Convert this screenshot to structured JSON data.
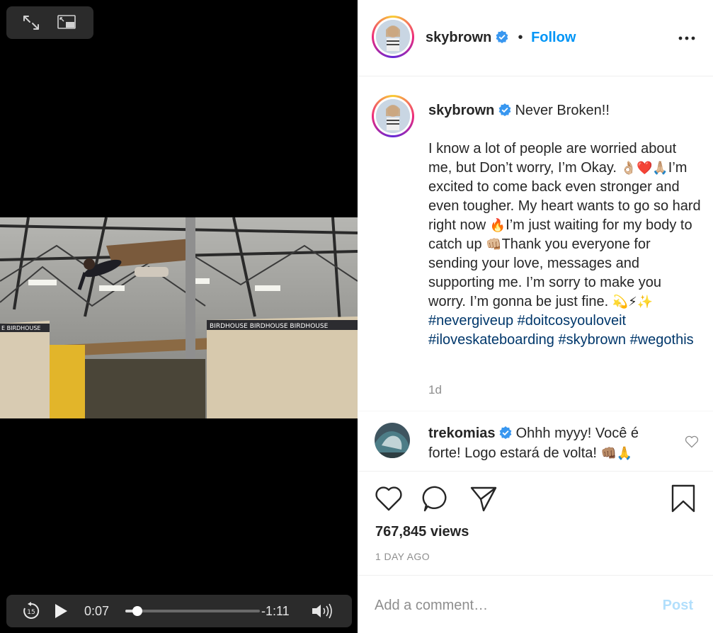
{
  "video": {
    "current_time": "0:07",
    "remaining_time": "-1:11",
    "progress": 0.09,
    "icons": {
      "expand": "expand-icon",
      "pip": "picture-in-picture-icon",
      "skip_back": "skip-back-15-icon",
      "skip_back_label": "15",
      "play": "play-icon",
      "volume": "volume-icon"
    },
    "frame_colors": {
      "ceiling": "#9a9a96",
      "ramp": "#d7c9ad",
      "banner": "#2c2c30",
      "banner_text": "BIRDHOUSE BIRDHOUSE BIRDHOUSE"
    }
  },
  "header": {
    "username": "skybrown",
    "separator": "•",
    "follow_label": "Follow",
    "more_icon": "more-options-icon"
  },
  "caption": {
    "username": "skybrown",
    "title": "Never Broken!!",
    "body_parts": [
      "I know a lot of people are worried about me, but Don’t worry, I’m Okay. ",
      "👌🏼❤️🙏🏼",
      "I’m excited to come back even stronger and even tougher. My heart wants to go so hard right now ",
      "🔥",
      "I’m just waiting for my body to catch up ",
      "👊🏼",
      "Thank you everyone for sending your love, messages and supporting me. I’m sorry to make you worry. I’m gonna be just fine. ",
      "💫⚡✨"
    ],
    "hashtags": "#nevergiveup #doitcosyouloveit #iloveskateboarding #skybrown #wegothis",
    "age": "1d"
  },
  "comment": {
    "username": "trekomias",
    "text": "Ohhh myyy! Você é forte! Logo estará de volta! ",
    "emoji": "👊🏽🙏"
  },
  "actions": {
    "like": "heart-icon",
    "comment": "comment-icon",
    "share": "share-icon",
    "save": "bookmark-icon"
  },
  "stats": {
    "views": "767,845 views",
    "date": "1 DAY AGO"
  },
  "compose": {
    "placeholder": "Add a comment…",
    "post_label": "Post"
  },
  "colors": {
    "link": "#0095f6",
    "hashtag": "#00376b",
    "muted": "#8e8e8e",
    "post_disabled": "#b2dffc",
    "verified": "#3897f0"
  }
}
